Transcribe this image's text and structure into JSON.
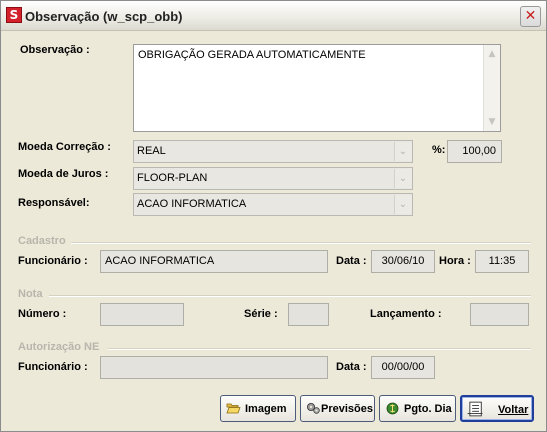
{
  "window": {
    "title": "Observação (w_scp_obb)",
    "app_icon_letter": "S",
    "close_glyph": "✕"
  },
  "observacao": {
    "label": "Observação :",
    "value": "OBRIGAÇÃO GERADA AUTOMATICAMENTE"
  },
  "moeda_correcao": {
    "label": "Moeda Correção :",
    "value": "REAL"
  },
  "percent": {
    "label": "%:",
    "value": "100,00"
  },
  "moeda_juros": {
    "label": "Moeda de Juros :",
    "value": "FLOOR-PLAN"
  },
  "responsavel": {
    "label": "Responsável:",
    "value": "ACAO INFORMATICA"
  },
  "cadastro": {
    "group_label": "Cadastro",
    "funcionario_label": "Funcionário :",
    "funcionario_value": "ACAO INFORMATICA",
    "data_label": "Data :",
    "data_value": "30/06/10",
    "hora_label": "Hora :",
    "hora_value": "11:35"
  },
  "nota": {
    "group_label": "Nota",
    "numero_label": "Número :",
    "numero_value": "",
    "serie_label": "Série :",
    "serie_value": "",
    "lancamento_label": "Lançamento :",
    "lancamento_value": ""
  },
  "autorizacao": {
    "group_label": "Autorização NE",
    "funcionario_label": "Funcionário :",
    "funcionario_value": "",
    "data_label": "Data :",
    "data_value": "00/00/00"
  },
  "buttons": {
    "imagem": "Imagem",
    "previsoes": "Previsões",
    "pgto_dia": "Pgto. Dia",
    "voltar": "Voltar"
  },
  "icons": {
    "app": "app-logo-icon",
    "close": "close-icon",
    "imagem": "folder-open-icon",
    "previsoes": "gears-icon",
    "pgto_dia": "money-icon",
    "voltar": "exit-list-icon",
    "scroll_up": "chevron-up-icon",
    "scroll_down": "chevron-down-icon"
  },
  "colors": {
    "window_bg": "#ece9d8",
    "close_x": "#c81e1e",
    "app_icon": "#d4202a",
    "disabled_group_text": "#b8b6ac",
    "button_border": "#4c5b7a"
  }
}
